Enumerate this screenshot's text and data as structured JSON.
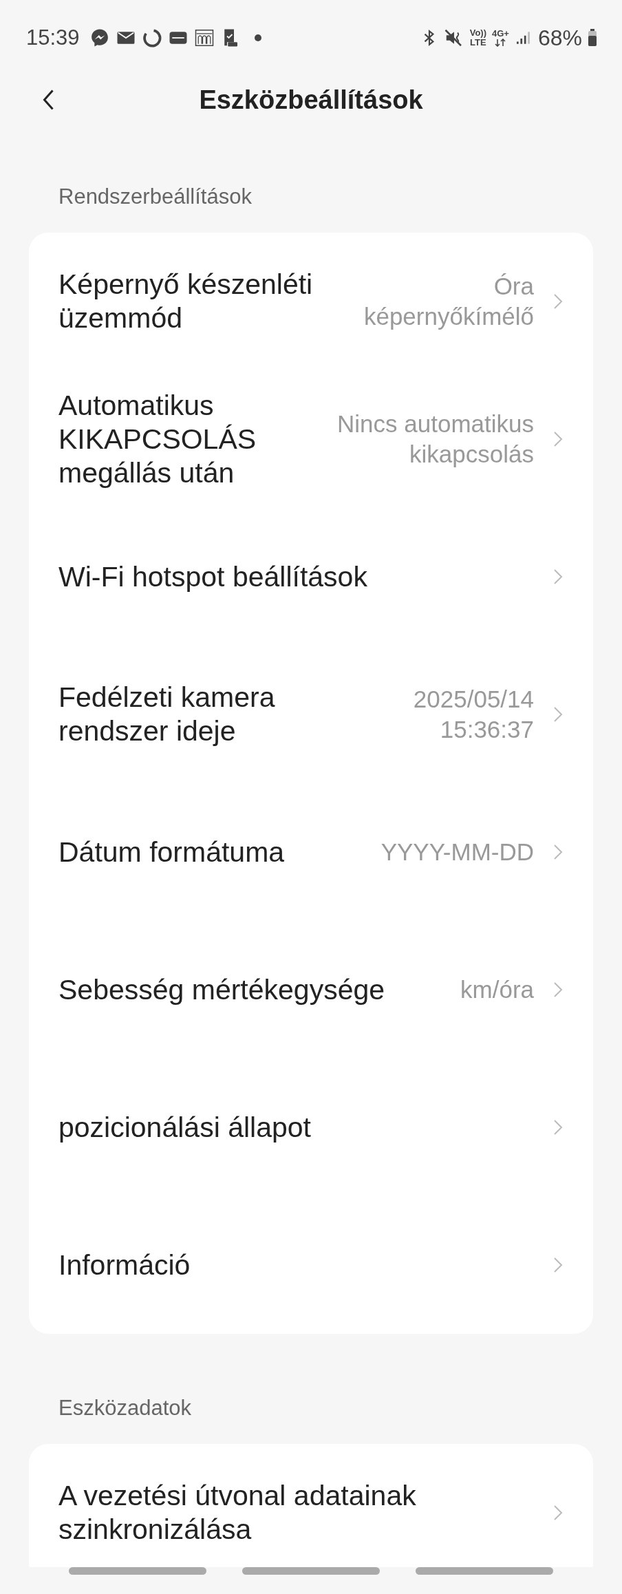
{
  "status_bar": {
    "time": "15:39",
    "volte_top": "Vo))",
    "volte_bottom": "LTE",
    "network": "4G+",
    "battery": "68%"
  },
  "header": {
    "title": "Eszközbeállítások"
  },
  "sections": [
    {
      "title": "Rendszerbeállítások",
      "rows": [
        {
          "label": "Képernyő készenléti üzemmód",
          "value": "Óra képernyőkímélő"
        },
        {
          "label": "Automatikus KIKAPCSOLÁS megállás után",
          "value": "Nincs automatikus kikapcsolás"
        },
        {
          "label": "Wi-Fi hotspot beállítások"
        },
        {
          "label": "Fedélzeti kamera rendszer ideje",
          "value": "2025/05/14 15:36:37"
        },
        {
          "label": "Dátum formátuma",
          "value": "YYYY-MM-DD"
        },
        {
          "label": "Sebesség mértékegysége",
          "value": "km/óra"
        },
        {
          "label": "pozicionálási állapot"
        },
        {
          "label": "Információ"
        }
      ]
    },
    {
      "title": "Eszközadatok",
      "rows": [
        {
          "label": "A vezetési útvonal adatainak szinkronizálása"
        }
      ]
    }
  ]
}
